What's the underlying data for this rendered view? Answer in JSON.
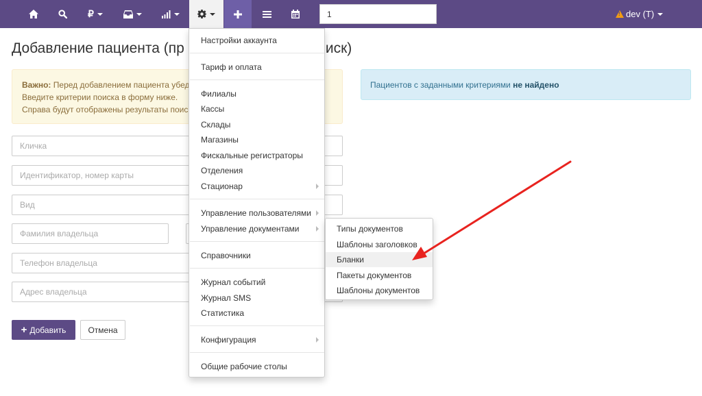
{
  "navbar": {
    "icons": [
      "home-icon",
      "search-icon",
      "ruble-icon",
      "inbox-icon",
      "bar-chart-icon",
      "gear-icon",
      "plus-icon",
      "list-icon",
      "calendar-icon"
    ],
    "search_value": "1",
    "user_label": "dev",
    "user_suffix": "(T)",
    "bg_color": "#5c4a85"
  },
  "page": {
    "title": "Добавление пациента (пр",
    "title_tail": "иск)"
  },
  "warning": {
    "bold": "Важно:",
    "line1": "Перед добавлением пациента убед",
    "line2": "Введите критерии поиска в форму ниже.",
    "line3": "Справа будут отображены результаты поис"
  },
  "info": {
    "text": "Пациентов с заданными критериями",
    "bold": "не найдено"
  },
  "form": {
    "nickname_placeholder": "Кличка",
    "identifier_placeholder": "Идентификатор, номер карты",
    "species_placeholder": "Вид",
    "owner_lastname_placeholder": "Фамилия владельца",
    "owner_phone_placeholder": "Телефон владельца",
    "owner_address_placeholder": "Адрес владельца",
    "add_label": "Добавить",
    "cancel_label": "Отмена"
  },
  "settings_menu": {
    "account_settings": "Настройки аккаунта",
    "tariff": "Тариф и оплата",
    "branches": "Филиалы",
    "cashboxes": "Кассы",
    "warehouses": "Склады",
    "stores": "Магазины",
    "fiscal": "Фискальные регистраторы",
    "departments": "Отделения",
    "hospital": "Стационар",
    "user_management": "Управление пользователями",
    "document_management": "Управление документами",
    "references": "Справочники",
    "event_log": "Журнал событий",
    "sms_log": "Журнал SMS",
    "statistics": "Статистика",
    "configuration": "Конфигурация",
    "shared_desktops": "Общие рабочие столы"
  },
  "documents_submenu": {
    "types": "Типы документов",
    "header_templates": "Шаблоны заголовков",
    "blanks": "Бланки",
    "packages": "Пакеты документов",
    "templates": "Шаблоны документов"
  },
  "annotation": {
    "arrow_color": "#e8231f"
  }
}
